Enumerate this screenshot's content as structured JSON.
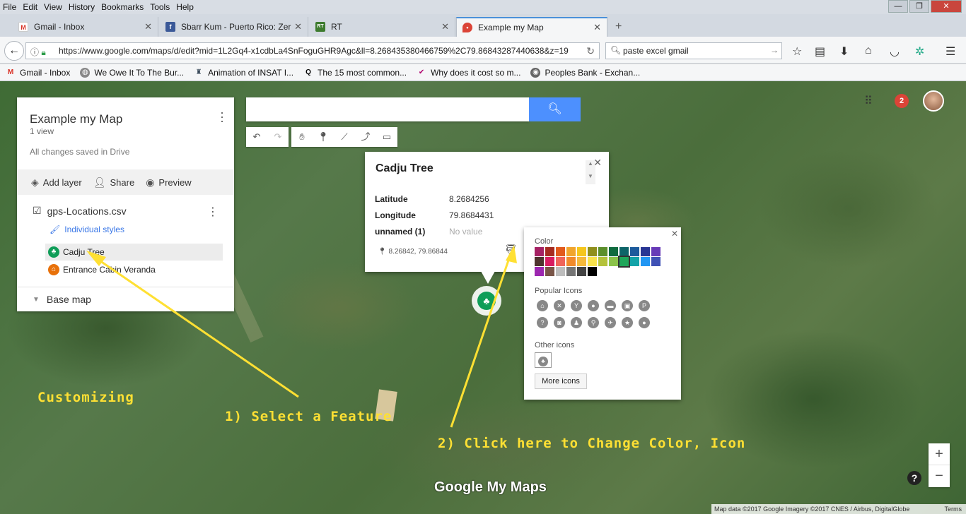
{
  "browser": {
    "menu": [
      "File",
      "Edit",
      "View",
      "History",
      "Bookmarks",
      "Tools",
      "Help"
    ],
    "window_controls": [
      "—",
      "❐",
      "✕"
    ],
    "tabs": [
      {
        "label": "Gmail - Inbox",
        "icon": "gmail-icon"
      },
      {
        "label": "Sbarr Kum - Puerto Rico: Zer",
        "icon": "facebook-icon"
      },
      {
        "label": "RT",
        "icon": "rt-icon"
      },
      {
        "label": "Example my Map",
        "icon": "maps-pin-icon",
        "active": true
      }
    ],
    "new_tab": "+",
    "url": "https://www.google.com/maps/d/edit?mid=1L2Gq4-x1cdbLa4SnFoguGHR9Agc&ll=8.268435380466759%2C79.86843287440638&z=19",
    "search_value": "paste excel gmail",
    "bookmarks": [
      "Gmail - Inbox",
      "We Owe It To The Bur...",
      "Animation of INSAT I...",
      "The 15 most common...",
      "Why does it cost so m...",
      "Peoples Bank - Exchan..."
    ]
  },
  "panel": {
    "title": "Example my Map",
    "views": "1 view",
    "saved": "All changes saved in Drive",
    "actions": {
      "add_layer": "Add layer",
      "share": "Share",
      "preview": "Preview"
    },
    "layer_name": "gps-Locations.csv",
    "styles_link": "Individual styles",
    "features": [
      "Cadju Tree",
      "Entrance Cabin Veranda"
    ],
    "base_map": "Base map"
  },
  "info_window": {
    "title": "Cadju Tree",
    "rows": [
      {
        "key": "Latitude",
        "value": "8.2684256"
      },
      {
        "key": "Longitude",
        "value": "79.8684431"
      },
      {
        "key": "unnamed (1)",
        "value": "No value"
      }
    ],
    "coords": "8.26842, 79.86844"
  },
  "style_popup": {
    "color_label": "Color",
    "colors": [
      "#a52163",
      "#a62a1f",
      "#e25a1c",
      "#f1a52c",
      "#f5c61c",
      "#8f8f1c",
      "#5b8f2b",
      "#0f6b3f",
      "#0e6468",
      "#1c5a9c",
      "#283593",
      "#673ab7",
      "#4e342e",
      "#d81b60",
      "#f0645a",
      "#f18a2b",
      "#f5b93b",
      "#f8e24b",
      "#b4c23b",
      "#8bc34a",
      "#1fa65a",
      "#12a3a8",
      "#2196f3",
      "#3f51b5",
      "#9c27b0",
      "#795548",
      "#bdbdbd",
      "#757575",
      "#424242",
      "#000000"
    ],
    "selected_color": "#1fa65a",
    "popular_icons_label": "Popular Icons",
    "popular_icons": [
      "home-icon",
      "restaurant-icon",
      "bar-icon",
      "chat-icon",
      "bus-icon",
      "shopping-icon",
      "parking-icon",
      "help-icon",
      "camera-icon",
      "walk-icon",
      "bike-icon",
      "run-icon",
      "star-icon",
      "pin-icon"
    ],
    "other_icons_label": "Other icons",
    "more_icons": "More icons"
  },
  "annotations": {
    "heading": "Customizing",
    "step1": "1) Select a Feature",
    "step2": "2) Click here to Change Color, Icon"
  },
  "map": {
    "notifications": "2",
    "zoom_in": "+",
    "zoom_out": "−",
    "help": "?",
    "logo": "Google My Maps",
    "attribution": "Map data ©2017 Google Imagery ©2017 CNES / Airbus, DigitalGlobe",
    "terms": "Terms"
  }
}
